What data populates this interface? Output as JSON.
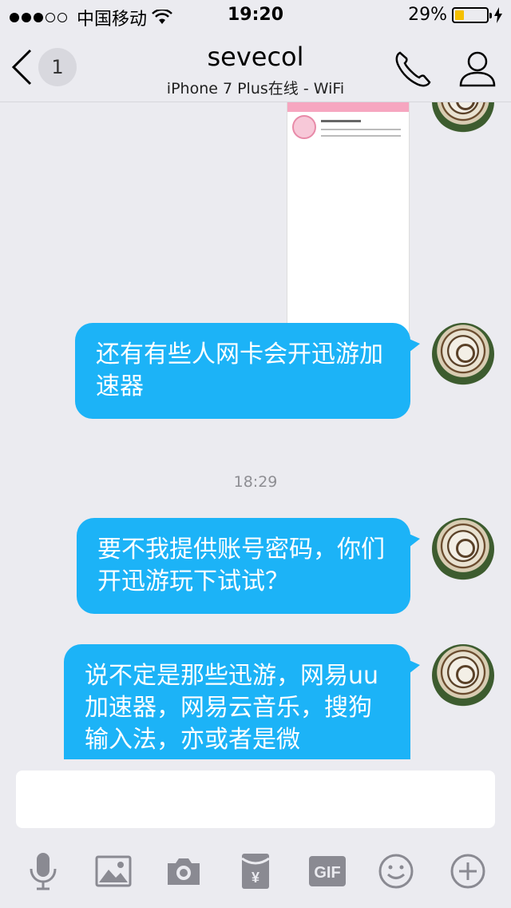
{
  "status_bar": {
    "carrier": "中国移动",
    "time": "19:20",
    "battery_percent": "29%",
    "battery_level": 0.29
  },
  "nav": {
    "unread_count": "1",
    "title": "sevecol",
    "subtitle": "iPhone 7 Plus在线 - WiFi"
  },
  "messages": [
    {
      "text": "还有有些人网卡会开迅游加速器"
    },
    {
      "text": "要不我提供账号密码，你们开迅游玩下试试？"
    },
    {
      "text": "说不定是那些迅游，网易uu加速器，网易云音乐，搜狗输入法，亦或者是微"
    }
  ],
  "timestamp": "18:29",
  "input": {
    "placeholder": ""
  },
  "toolbar": {
    "gif_label": "GIF",
    "icons": [
      "microphone-icon",
      "image-icon",
      "camera-icon",
      "red-packet-icon",
      "gif-icon",
      "emoji-icon",
      "plus-icon"
    ]
  },
  "colors": {
    "bubble": "#1cb3f7",
    "background": "#ebebf0",
    "battery": "#f5c000"
  }
}
